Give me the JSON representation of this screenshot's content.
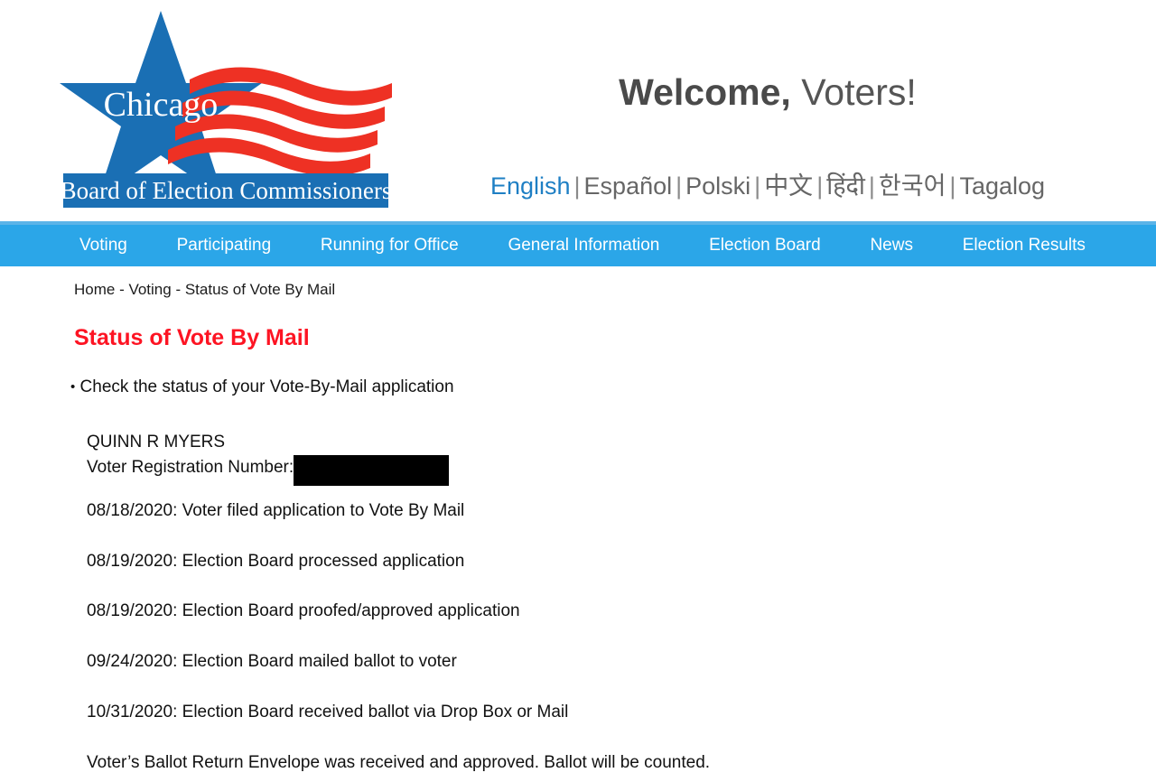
{
  "header": {
    "logo": {
      "alt": "Chicago Board of Election Commissioners",
      "star_text": "Chicago",
      "banner_text": "Board of Election Commissioners",
      "star_color": "#1a6fb4",
      "stripe_color": "#ee3124"
    },
    "welcome_bold": "Welcome,",
    "welcome_regular": " Voters!"
  },
  "languages": {
    "separator": "|",
    "items": [
      {
        "label": "English",
        "active": true
      },
      {
        "label": "Español",
        "active": false
      },
      {
        "label": "Polski",
        "active": false
      },
      {
        "label": "中文",
        "active": false
      },
      {
        "label": "हिंदी",
        "active": false
      },
      {
        "label": "한국어",
        "active": false
      },
      {
        "label": "Tagalog",
        "active": false
      }
    ],
    "active_color": "#1e7fc4",
    "inactive_color": "#666666"
  },
  "nav": {
    "background": "#2ba6e8",
    "top_strip_color": "#5bb4e8",
    "items": [
      {
        "label": "Voting"
      },
      {
        "label": "Participating"
      },
      {
        "label": "Running for Office"
      },
      {
        "label": "General Information"
      },
      {
        "label": "Election Board"
      },
      {
        "label": "News"
      },
      {
        "label": "Election Results"
      }
    ]
  },
  "main": {
    "breadcrumb": "Home - Voting - Status of Vote By Mail",
    "page_title": "Status of Vote By Mail",
    "title_color": "#fd1423",
    "bullet_marker": "•",
    "bullet_text": "Check the status of your Vote-By-Mail application",
    "voter": {
      "name": "QUINN R MYERS",
      "registration_label": "Voter Registration Number:",
      "registration_value_redacted": true
    },
    "status_entries": [
      "08/18/2020: Voter filed application to Vote By Mail",
      "08/19/2020: Election Board processed application",
      "08/19/2020: Election Board proofed/approved application",
      "09/24/2020: Election Board mailed ballot to voter",
      "10/31/2020: Election Board received ballot via Drop Box or Mail"
    ],
    "final_status": "Voter’s Ballot Return Envelope was received and approved. Ballot will be counted."
  }
}
